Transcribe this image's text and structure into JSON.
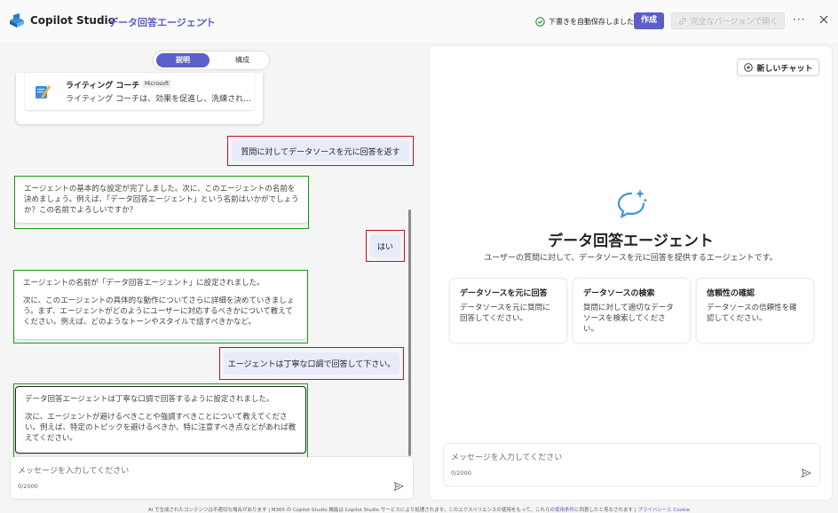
{
  "header": {
    "app_title": "Copilot Studio",
    "agent_name": "データ回答エージェント",
    "save_status": "下書きを自動保存しました",
    "create_label": "作成",
    "full_version_label": "完全なバージョンで開く",
    "more_label": "···"
  },
  "toggle": {
    "describe_label": "説明",
    "configure_label": "構成"
  },
  "coach_card": {
    "name": "ライティング コーチ",
    "badge": "Microsoft",
    "description": "ライティング コーチは、効果を促進し、洗練され..."
  },
  "messages": {
    "user1": "質問に対してデータソースを元に回答を返す",
    "bot1": "エージェントの基本的な設定が完了しました。次に、このエージェントの名前を決めましょう。例えば、「データ回答エージェント」という名前はいかがでしょうか？この名前でよろしいですか？",
    "user2": "はい",
    "bot2_p1": "エージェントの名前が「データ回答エージェント」に設定されました。",
    "bot2_p2": "次に、このエージェントの具体的な動作についてさらに詳細を決めていきましょう。まず、エージェントがどのようにユーザーに対応するべきかについて教えてください。例えば、どのようなトーンやスタイルで話すべきかなど。",
    "user3": "エージェントは丁寧な口調で回答して下さい。",
    "bot3_p1": "データ回答エージェントは丁寧な口調で回答するように設定されました。",
    "bot3_p2": "次に、エージェントが避けるべきことや強調すべきことについて教えてください。例えば、特定のトピックを避けるべきか、特に注意すべき点などがあれば教えてください。"
  },
  "left_input": {
    "placeholder": "メッセージを入力してください",
    "count": "0/2000"
  },
  "right_panel": {
    "new_chat_label": "新しいチャット",
    "title": "データ回答エージェント",
    "subtitle": "ユーザーの質問に対して、データソースを元に回答を提供するエージェントです。",
    "suggestions": [
      {
        "title": "データソースを元に回答",
        "desc": "データソースを元に質問に回答してください。"
      },
      {
        "title": "データソースの検索",
        "desc": "質問に対して適切なデータソースを検索してください。"
      },
      {
        "title": "信頼性の確認",
        "desc": "データソースの信頼性を確認してください。"
      }
    ],
    "input_placeholder": "メッセージを入力してください",
    "input_count": "0/2000"
  },
  "footer": {
    "text": "AI で生成されたコンテンツは不適切な場合があります | M365 の Copilot Studio 機能は Copilot Studio サービスにより処理されます。このエクスペリエンスの使用をもって、これらの",
    "terms_link": "使用条件",
    "text2": "に同意したと見なされます | ",
    "privacy_link": "プライバシーと Cookie"
  },
  "colors": {
    "accent": "#5b5fc7",
    "user_highlight": "#c50f1f",
    "bot_highlight": "#13a10e"
  }
}
